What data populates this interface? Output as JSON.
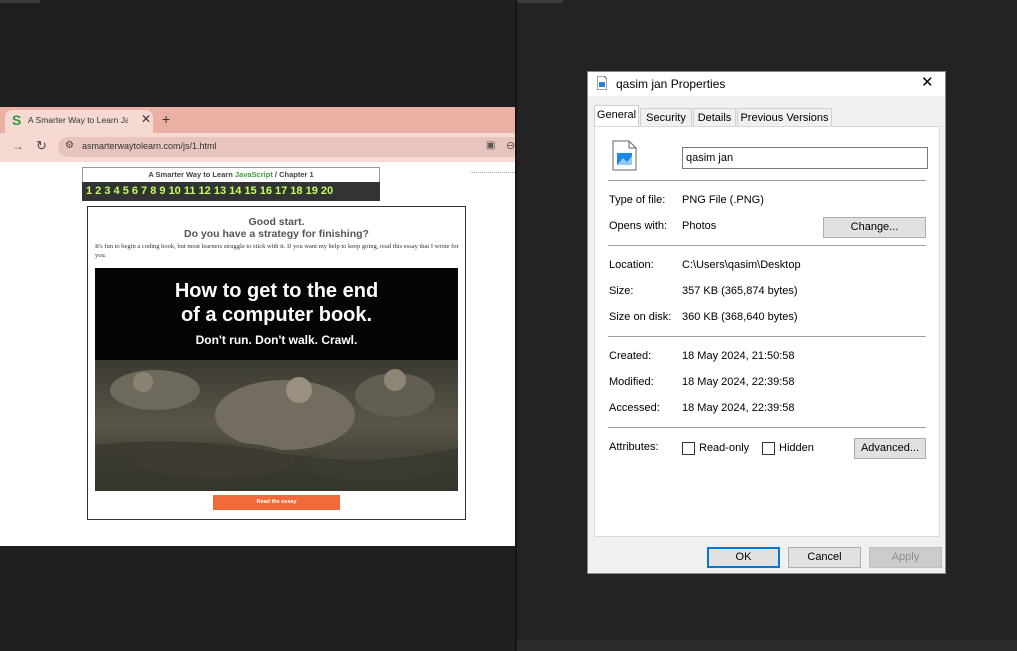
{
  "browser": {
    "tab_title": "A Smarter Way to Learn JavaScript",
    "tab_favicon": "S",
    "url": "asmarterwaytolearn.com/js/1.html",
    "page": {
      "header_prefix": "A Smarter Way to Learn ",
      "header_js": "JavaScript",
      "header_suffix": " / Chapter 1",
      "chapters": "1 2 3 4 5 6 7 8 9 10 11 12 13 14 15 16 17 18 19 20",
      "essay_heading_1": "Good start.",
      "essay_heading_2": "Do you have a strategy for finishing?",
      "essay_text": "It's fun to begin a coding book, but most learners struggle to stick with it. If you want my help to keep going, read this essay that I wrote for you.",
      "hero_line_1": "How to get to the end",
      "hero_line_2": "of a computer book.",
      "hero_line_3": "Don't run. Don't walk. Crawl.",
      "read_button": "Read the essay",
      "accent_color": "#f26a3a"
    }
  },
  "dialog": {
    "title": "qasim jan Properties",
    "tabs": [
      "General",
      "Security",
      "Details",
      "Previous Versions"
    ],
    "active_tab": "General",
    "file_name": "qasim jan",
    "type_label": "Type of file:",
    "type_value": "PNG File (.PNG)",
    "opens_label": "Opens with:",
    "opens_value": "Photos",
    "change_button": "Change...",
    "location_label": "Location:",
    "location_value": "C:\\Users\\qasim\\Desktop",
    "size_label": "Size:",
    "size_value": "357 KB (365,874 bytes)",
    "size_disk_label": "Size on disk:",
    "size_disk_value": "360 KB (368,640 bytes)",
    "created_label": "Created:",
    "created_value": "18 May 2024, 21:50:58",
    "modified_label": "Modified:",
    "modified_value": "18 May 2024, 22:39:58",
    "accessed_label": "Accessed:",
    "accessed_value": "18 May 2024, 22:39:58",
    "attributes_label": "Attributes:",
    "readonly_label": "Read-only",
    "hidden_label": "Hidden",
    "advanced_button": "Advanced...",
    "ok_button": "OK",
    "cancel_button": "Cancel",
    "apply_button": "Apply"
  }
}
